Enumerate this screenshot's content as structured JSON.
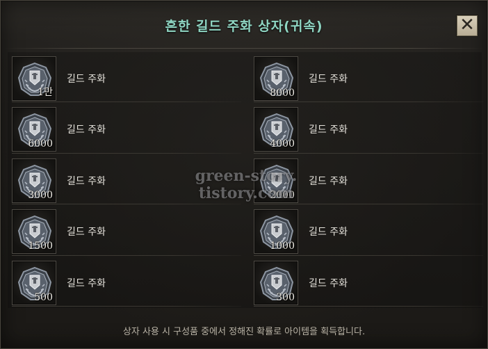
{
  "window": {
    "title": "흔한 길드 주화 상자(귀속)",
    "close_symbol": "✕",
    "footer": "상자 사용 시 구성품 중에서 정해진 확률로 아이템을 획득합니다."
  },
  "items_left": [
    {
      "name": "길드 주화",
      "qty": "1만",
      "icon": "guild-coin-icon"
    },
    {
      "name": "길드 주화",
      "qty": "6000",
      "icon": "guild-coin-icon"
    },
    {
      "name": "길드 주화",
      "qty": "3000",
      "icon": "guild-coin-icon"
    },
    {
      "name": "길드 주화",
      "qty": "1500",
      "icon": "guild-coin-icon"
    },
    {
      "name": "길드 주화",
      "qty": "500",
      "icon": "guild-coin-icon"
    }
  ],
  "items_right": [
    {
      "name": "길드 주화",
      "qty": "8000",
      "icon": "guild-coin-icon"
    },
    {
      "name": "길드 주화",
      "qty": "4000",
      "icon": "guild-coin-icon"
    },
    {
      "name": "길드 주화",
      "qty": "2000",
      "icon": "guild-coin-icon"
    },
    {
      "name": "길드 주화",
      "qty": "1000",
      "icon": "guild-coin-icon"
    },
    {
      "name": "길드 주화",
      "qty": "300",
      "icon": "guild-coin-icon"
    }
  ],
  "watermark": {
    "line1": "green-story.",
    "line2": "tistory.com"
  },
  "colors": {
    "title": "#8fd6c3",
    "item_text": "#e6e3dc",
    "footer_text": "#b9b3a6"
  }
}
